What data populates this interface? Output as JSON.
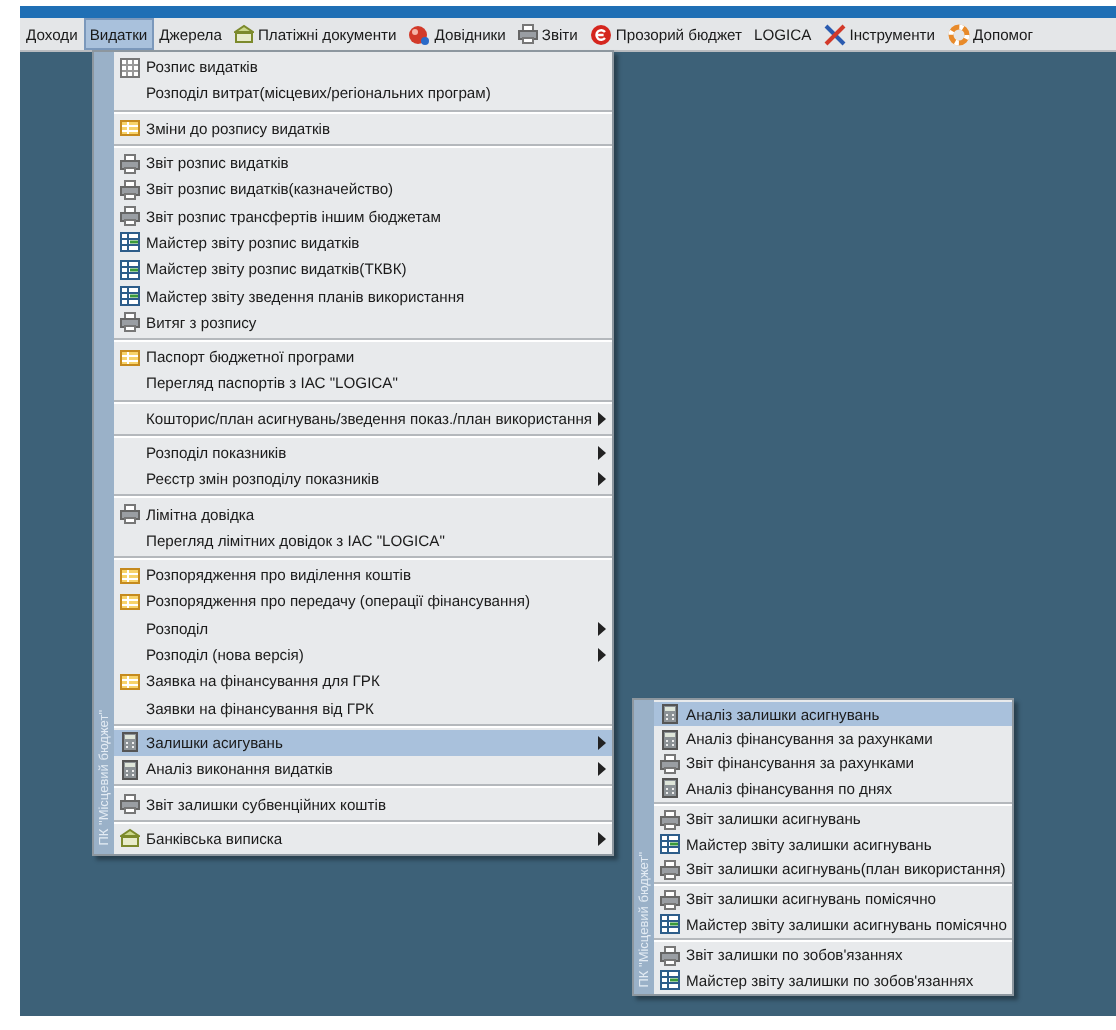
{
  "menubar": [
    {
      "label": "Доходи",
      "kind": "plain",
      "selected": false
    },
    {
      "label": "Видатки",
      "kind": "plain",
      "selected": true
    },
    {
      "label": "Джерела",
      "kind": "plain",
      "selected": false
    },
    {
      "label": "Платіжні документи",
      "kind": "bank",
      "selected": false
    },
    {
      "label": "Довідники",
      "kind": "globe",
      "selected": false
    },
    {
      "label": "Звіти",
      "kind": "printer",
      "selected": false
    },
    {
      "label": "Прозорий бюджет",
      "kind": "coin",
      "selected": false
    },
    {
      "label": "LOGICA",
      "kind": "plain",
      "selected": false
    },
    {
      "label": "Інструменти",
      "kind": "tools",
      "selected": false
    },
    {
      "label": "Допомог",
      "kind": "lifebuoy",
      "selected": false
    }
  ],
  "menu": {
    "strip": "ПК \"Місцевий бюджет\"",
    "items": [
      {
        "kind": "grid",
        "label": "Розпис видатків",
        "submenu": false,
        "selected": false
      },
      {
        "kind": "plain",
        "label": "Розподіл витрат(місцевих/регіональних програм)",
        "submenu": false,
        "selected": false
      },
      {
        "kind": "separator"
      },
      {
        "kind": "table",
        "label": "Зміни до розпису видатків",
        "submenu": false,
        "selected": false
      },
      {
        "kind": "separator"
      },
      {
        "kind": "printer",
        "label": "Звіт розпис видатків",
        "submenu": false,
        "selected": false
      },
      {
        "kind": "printer",
        "label": "Звіт розпис видатків(казначейство)",
        "submenu": false,
        "selected": false
      },
      {
        "kind": "printer",
        "label": "Звіт розпис трансфертів іншим бюджетам",
        "submenu": false,
        "selected": false
      },
      {
        "kind": "wizard",
        "label": "Майстер звіту розпис видатків",
        "submenu": false,
        "selected": false
      },
      {
        "kind": "wizard",
        "label": "Майстер звіту розпис видатків(ТКВК)",
        "submenu": false,
        "selected": false
      },
      {
        "kind": "wizard",
        "label": "Майстер звіту зведення планів використання",
        "submenu": false,
        "selected": false
      },
      {
        "kind": "printer",
        "label": "Витяг з розпису",
        "submenu": false,
        "selected": false
      },
      {
        "kind": "separator"
      },
      {
        "kind": "table",
        "label": "Паспорт бюджетної програми",
        "submenu": false,
        "selected": false
      },
      {
        "kind": "plain",
        "label": "Перегляд паспортів  з ІАС \"LOGICA\"",
        "submenu": false,
        "selected": false
      },
      {
        "kind": "separator"
      },
      {
        "kind": "plain",
        "label": "Кошторис/план асигнувань/зведення показ./план використання",
        "submenu": true,
        "selected": false
      },
      {
        "kind": "separator"
      },
      {
        "kind": "plain",
        "label": "Розподіл показників",
        "submenu": true,
        "selected": false
      },
      {
        "kind": "plain",
        "label": "Реєстр змін розподілу показників",
        "submenu": true,
        "selected": false
      },
      {
        "kind": "separator"
      },
      {
        "kind": "printer",
        "label": "Лімітна довідка",
        "submenu": false,
        "selected": false
      },
      {
        "kind": "plain",
        "label": "Перегляд лімітних довідок  з ІАС \"LOGICA\"",
        "submenu": false,
        "selected": false
      },
      {
        "kind": "separator"
      },
      {
        "kind": "table",
        "label": "Розпорядження про виділення коштів",
        "submenu": false,
        "selected": false
      },
      {
        "kind": "table",
        "label": "Розпорядження про передачу (операції фінансування)",
        "submenu": false,
        "selected": false
      },
      {
        "kind": "plain",
        "label": "Розподіл",
        "submenu": true,
        "selected": false
      },
      {
        "kind": "plain",
        "label": "Розподіл (нова версія)",
        "submenu": true,
        "selected": false
      },
      {
        "kind": "table",
        "label": "Заявка на фінансування для ГРК",
        "submenu": false,
        "selected": false
      },
      {
        "kind": "plain",
        "label": "Заявки на фінансування від ГРК",
        "submenu": false,
        "selected": false
      },
      {
        "kind": "separator"
      },
      {
        "kind": "calc",
        "label": "Залишки асигувань",
        "submenu": true,
        "selected": true
      },
      {
        "kind": "calc",
        "label": "Аналіз виконання видатків",
        "submenu": true,
        "selected": false
      },
      {
        "kind": "separator"
      },
      {
        "kind": "printer",
        "label": "Звіт залишки субвенційних коштів",
        "submenu": false,
        "selected": false
      },
      {
        "kind": "separator"
      },
      {
        "kind": "bank",
        "label": "Банківська виписка",
        "submenu": true,
        "selected": false
      }
    ]
  },
  "submenu": {
    "strip": "ПК \"Місцевий бюджет\"",
    "items": [
      {
        "kind": "calc",
        "label": "Аналіз залишки асигнувань",
        "submenu": false,
        "selected": true
      },
      {
        "kind": "calc",
        "label": "Аналіз фінансування за рахунками",
        "submenu": false,
        "selected": false
      },
      {
        "kind": "printer",
        "label": "Звіт фінансування за рахунками",
        "submenu": false,
        "selected": false
      },
      {
        "kind": "calc",
        "label": "Аналіз фінансування по днях",
        "submenu": false,
        "selected": false
      },
      {
        "kind": "separator"
      },
      {
        "kind": "printer",
        "label": "Звіт залишки асигнувань",
        "submenu": false,
        "selected": false
      },
      {
        "kind": "wizard",
        "label": "Майстер звіту залишки асигнувань",
        "submenu": false,
        "selected": false
      },
      {
        "kind": "printer",
        "label": "Звіт залишки асигнувань(план використання)",
        "submenu": false,
        "selected": false
      },
      {
        "kind": "separator"
      },
      {
        "kind": "printer",
        "label": "Звіт залишки асигнувань помісячно",
        "submenu": false,
        "selected": false
      },
      {
        "kind": "wizard",
        "label": "Майстер звіту залишки асигнувань помісячно",
        "submenu": false,
        "selected": false
      },
      {
        "kind": "separator"
      },
      {
        "kind": "printer",
        "label": "Звіт залишки по зобов'язаннях",
        "submenu": false,
        "selected": false
      },
      {
        "kind": "wizard",
        "label": "Майстер звіту залишки по зобов'язаннях",
        "submenu": false,
        "selected": false
      }
    ]
  }
}
